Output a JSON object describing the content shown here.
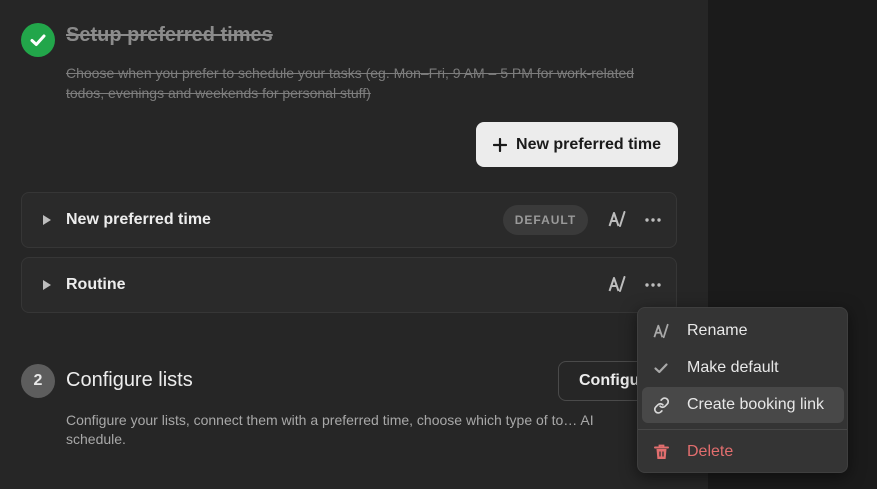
{
  "step1": {
    "title": "Setup preferred times",
    "description": "Choose when you prefer to schedule your tasks (eg. Mon–Fri, 9 AM – 5 PM for work-related todos, evenings and weekends for personal stuff)",
    "new_button_label": "New preferred time",
    "status_color": "#22a64a"
  },
  "preferred_times": [
    {
      "name": "New preferred time",
      "badge": "DEFAULT"
    },
    {
      "name": "Routine",
      "badge": ""
    }
  ],
  "step2": {
    "number": "2",
    "title": "Configure lists",
    "description": "Configure your lists, connect them with a preferred time, choose which type of to… AI schedule.",
    "button_label": "Configure"
  },
  "context_menu": {
    "items": [
      {
        "label": "Rename",
        "icon": "ai-rename-icon"
      },
      {
        "label": "Make default",
        "icon": "checkmark-icon"
      },
      {
        "label": "Create booking link",
        "icon": "link-icon"
      },
      {
        "label": "Delete",
        "icon": "trash-icon"
      }
    ],
    "danger_color": "#e26e6e"
  }
}
